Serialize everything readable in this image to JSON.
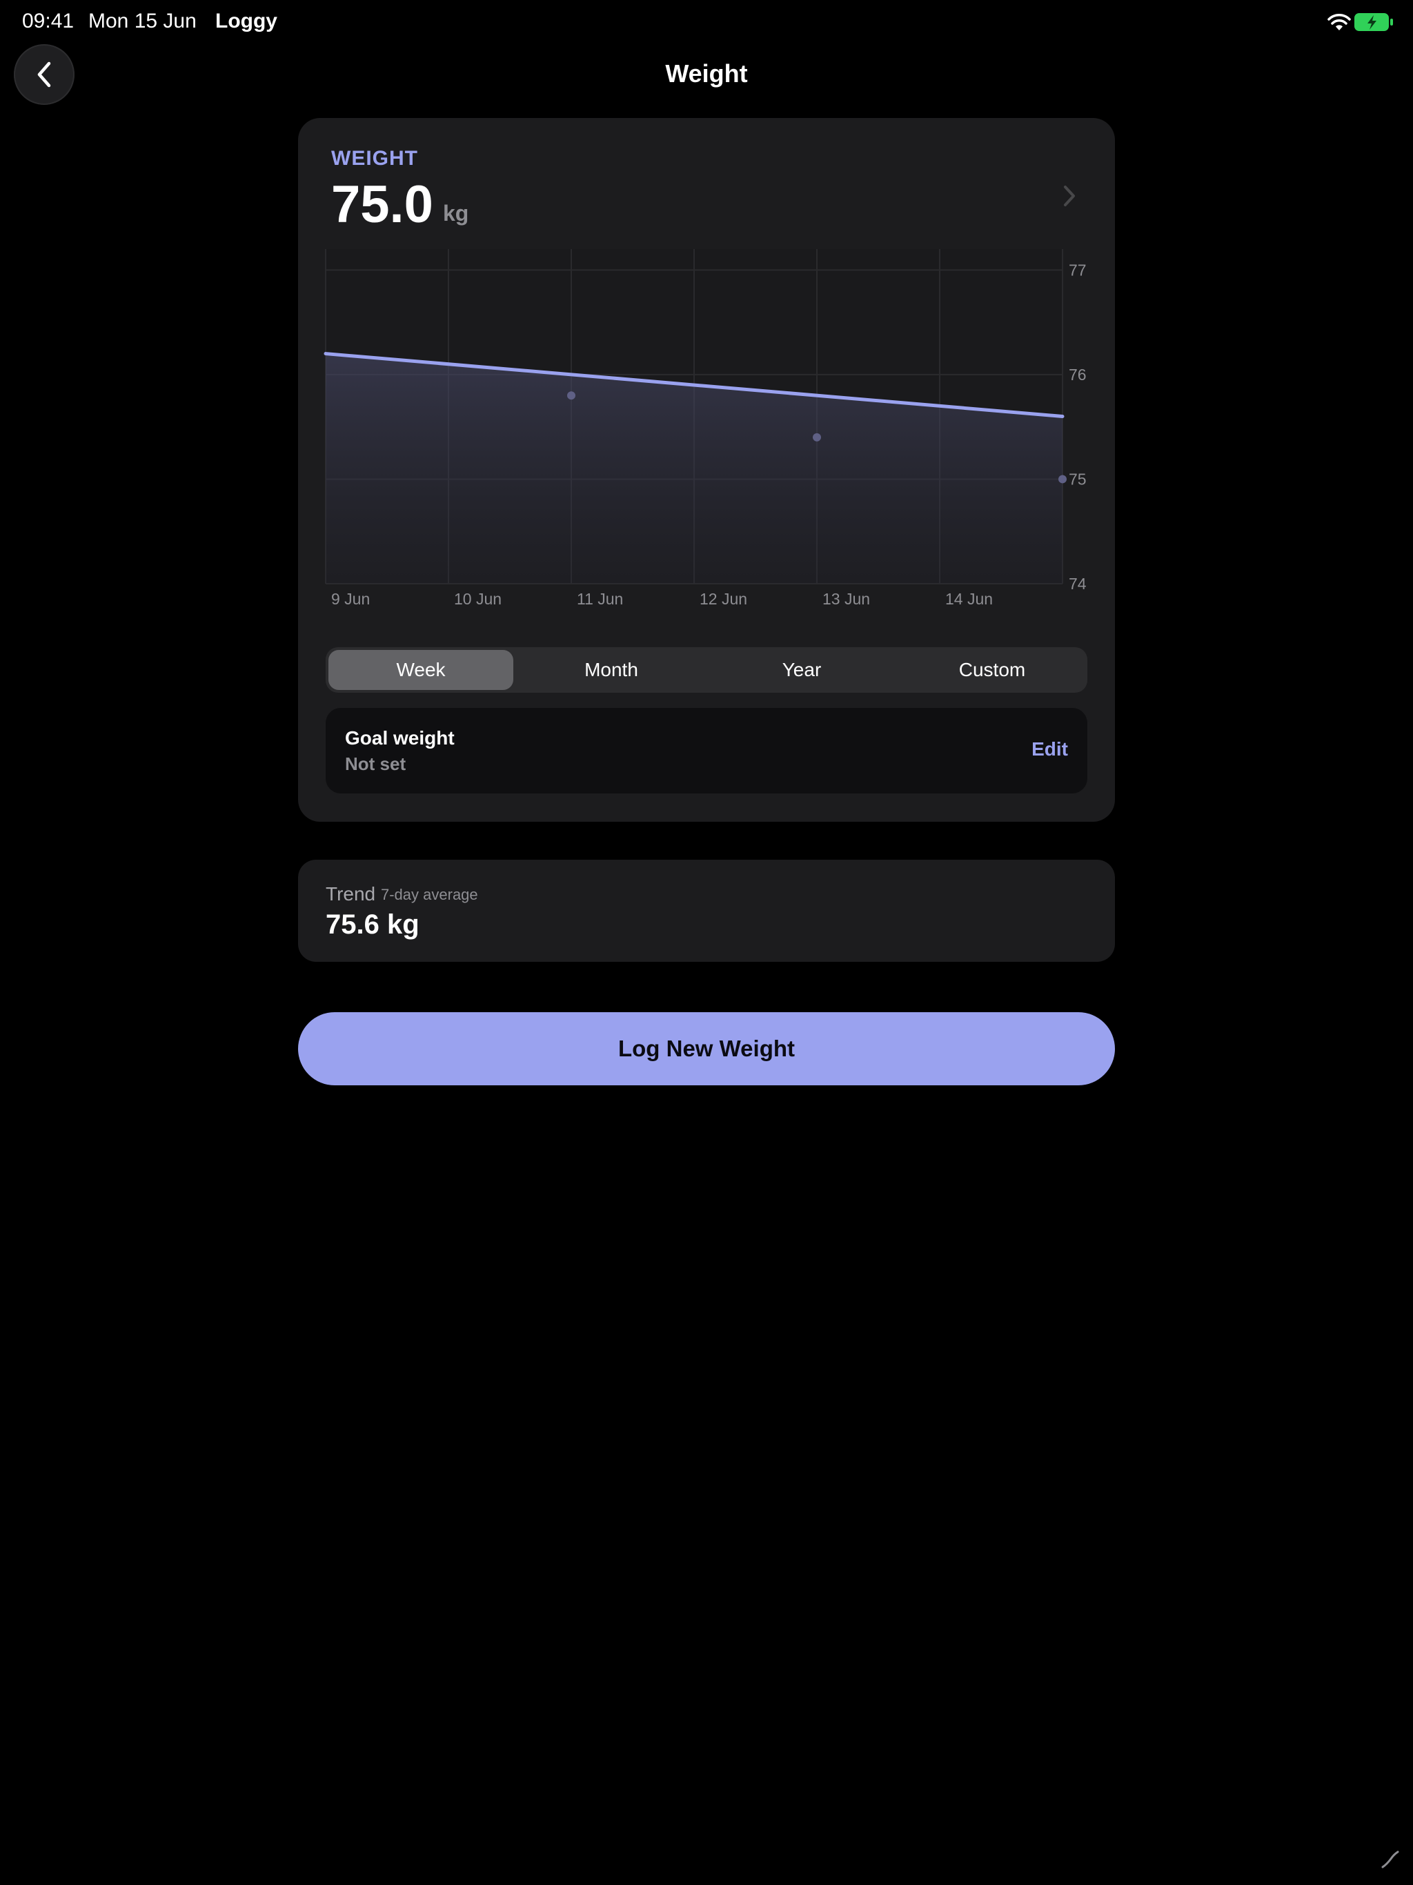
{
  "status_bar": {
    "time": "09:41",
    "date": "Mon 15 Jun",
    "app_name": "Loggy",
    "battery_color": "#30d158"
  },
  "nav": {
    "title": "Weight",
    "back_icon": "chevron-left-icon"
  },
  "weight_card": {
    "label": "WEIGHT",
    "value": "75.0",
    "unit": "kg",
    "chevron_icon": "chevron-right-icon"
  },
  "range_tabs": {
    "options": [
      "Week",
      "Month",
      "Year",
      "Custom"
    ],
    "selected": "Week"
  },
  "goal": {
    "title": "Goal weight",
    "value": "Not set",
    "edit_label": "Edit"
  },
  "trend": {
    "label": "Trend",
    "sublabel": "7-day average",
    "value": "75.6 kg"
  },
  "log_button": {
    "label": "Log New Weight"
  },
  "colors": {
    "accent": "#9aa2ef",
    "background": "#000000",
    "card": "#1c1c1e"
  },
  "chart_data": {
    "type": "line",
    "x_tick_labels": [
      "9 Jun",
      "10 Jun",
      "11 Jun",
      "12 Jun",
      "13 Jun",
      "14 Jun"
    ],
    "y_tick_labels": [
      "77",
      "76",
      "75",
      "74"
    ],
    "ylim": [
      74,
      77.2
    ],
    "xlim": [
      9,
      15
    ],
    "y_axis_position": "right",
    "grid": true,
    "trend_line": {
      "x": [
        9,
        15
      ],
      "y": [
        76.2,
        75.6
      ]
    },
    "points": {
      "x": [
        11,
        13,
        15
      ],
      "y": [
        75.8,
        75.4,
        75.0
      ]
    }
  }
}
